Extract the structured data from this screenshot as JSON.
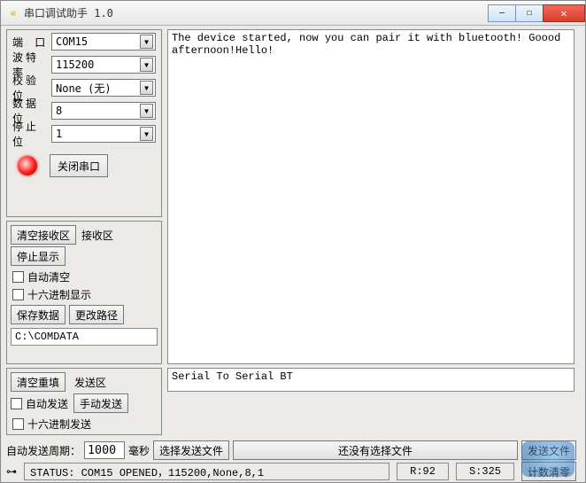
{
  "title": "串口调试助手 1.0",
  "app_icon_text": "«",
  "window_buttons": {
    "minimize": "—",
    "maximize": "☐",
    "close": "✕"
  },
  "conn": {
    "port_label": "端  口",
    "baud_label": "波特率",
    "parity_label": "校验位",
    "data_label": "数据位",
    "stop_label": "停止位",
    "port_value": "COM15",
    "baud_value": "115200",
    "parity_value": "None (无)",
    "data_value": "8",
    "stop_value": "1",
    "close_port_label": "关闭串口"
  },
  "recv_area": {
    "clear_btn": "清空接收区",
    "area_label": "接收区",
    "stop_disp_btn": "停止显示",
    "auto_clear_label": "自动清空",
    "hex_disp_label": "十六进制显示",
    "save_btn": "保存数据",
    "change_path_btn": "更改路径",
    "path_value": "C:\\COMDATA"
  },
  "send_area": {
    "clear_btn": "清空重填",
    "area_label": "发送区",
    "auto_send_label": "自动发送",
    "manual_send_btn": "手动发送",
    "hex_send_label": "十六进制发送"
  },
  "auto_line": {
    "period_label": "自动发送周期：",
    "period_value": "1000",
    "period_unit": "毫秒",
    "select_file_btn": "选择发送文件",
    "no_file_label": "还没有选择文件",
    "send_file_btn": "发送文件"
  },
  "status": {
    "text": "STATUS: COM15 OPENED，115200,None,8,1",
    "r_label": "R:92",
    "s_label": "S:325",
    "counter_reset_btn": "计数清零"
  },
  "recv_text": "The device started, now you can pair it with bluetooth! Goood afternoon!Hello!",
  "send_text": "Serial To Serial BT"
}
